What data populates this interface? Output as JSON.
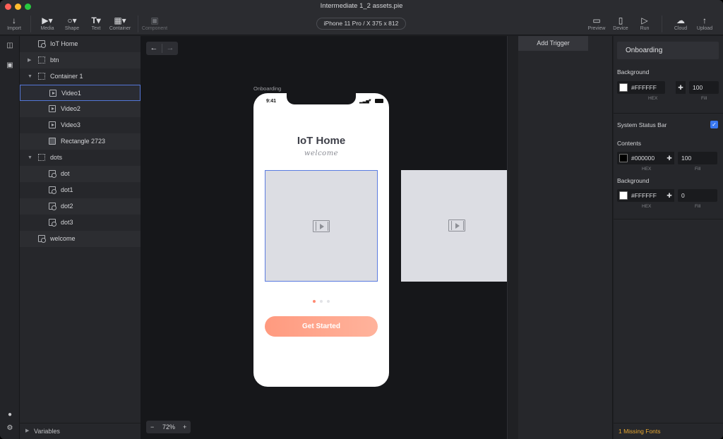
{
  "window": {
    "title": "Intermediate 1_2 assets.pie"
  },
  "toolbar": {
    "import": "Import",
    "media": "Media",
    "shape": "Shape",
    "text": "Text",
    "container": "Container",
    "component": "Component",
    "device": "iPhone 11 Pro / X  375 x 812",
    "preview": "Preview",
    "device_btn": "Device",
    "run": "Run",
    "cloud": "Cloud",
    "upload": "Upload"
  },
  "layers": [
    {
      "name": "IoT Home"
    },
    {
      "name": "btn"
    },
    {
      "name": "Container 1"
    },
    {
      "name": "Video1"
    },
    {
      "name": "Video2"
    },
    {
      "name": "Video3"
    },
    {
      "name": "Rectangle 2723"
    },
    {
      "name": "dots"
    },
    {
      "name": "dot"
    },
    {
      "name": "dot1"
    },
    {
      "name": "dot2"
    },
    {
      "name": "dot3"
    },
    {
      "name": "welcome"
    }
  ],
  "variables_label": "Variables",
  "canvas": {
    "zoom": "72%",
    "phone_label": "Onboarding",
    "status_time": "9:41",
    "app_title": "IoT Home",
    "app_subtitle": "welcome",
    "cta_label": "Get Started",
    "active_dot_index": 0
  },
  "triggers": {
    "add_trigger": "Add Trigger"
  },
  "inspector": {
    "title": "Onboarding",
    "background_label": "Background",
    "background_hex": "#FFFFFF",
    "background_fill": "100",
    "hex_caption": "HEX",
    "fill_caption": "Fill",
    "status_bar_label": "System Status Bar",
    "status_bar_checked": true,
    "contents_label": "Contents",
    "contents_hex": "#000000",
    "contents_fill": "100",
    "sb_background_label": "Background",
    "sb_background_hex": "#FFFFFF",
    "sb_background_fill": "0",
    "missing_fonts": "1 Missing Fonts"
  },
  "colors": {
    "accent": "#5b7ce0",
    "cta_start": "#ff9a7f",
    "cta_end": "#ffb39c",
    "warning": "#e7a730",
    "checkbox": "#3a78f0"
  }
}
